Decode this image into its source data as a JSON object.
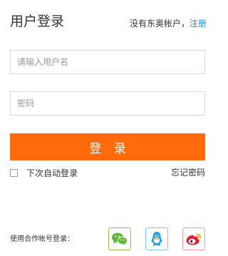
{
  "header": {
    "title": "用户登录",
    "register_prompt": "没有东奥帐户，",
    "register_link": "注册"
  },
  "form": {
    "username_placeholder": "请输入用户名",
    "username_value": "",
    "password_placeholder": "密码",
    "password_value": "",
    "login_label": "登 录",
    "remember_label": "下次自动登录",
    "remember_checked": false,
    "forgot_label": "忘记密码"
  },
  "social": {
    "label": "使用合作帐号登录：",
    "providers": [
      {
        "name": "wechat",
        "icon": "wechat-icon",
        "color": "#5fb534"
      },
      {
        "name": "qq",
        "icon": "qq-icon",
        "color": "#2aa3e0"
      },
      {
        "name": "weibo",
        "icon": "weibo-icon",
        "color": "#e6162d"
      }
    ]
  },
  "colors": {
    "primary_button": "#ff6a0a",
    "link": "#1a8fd8"
  }
}
